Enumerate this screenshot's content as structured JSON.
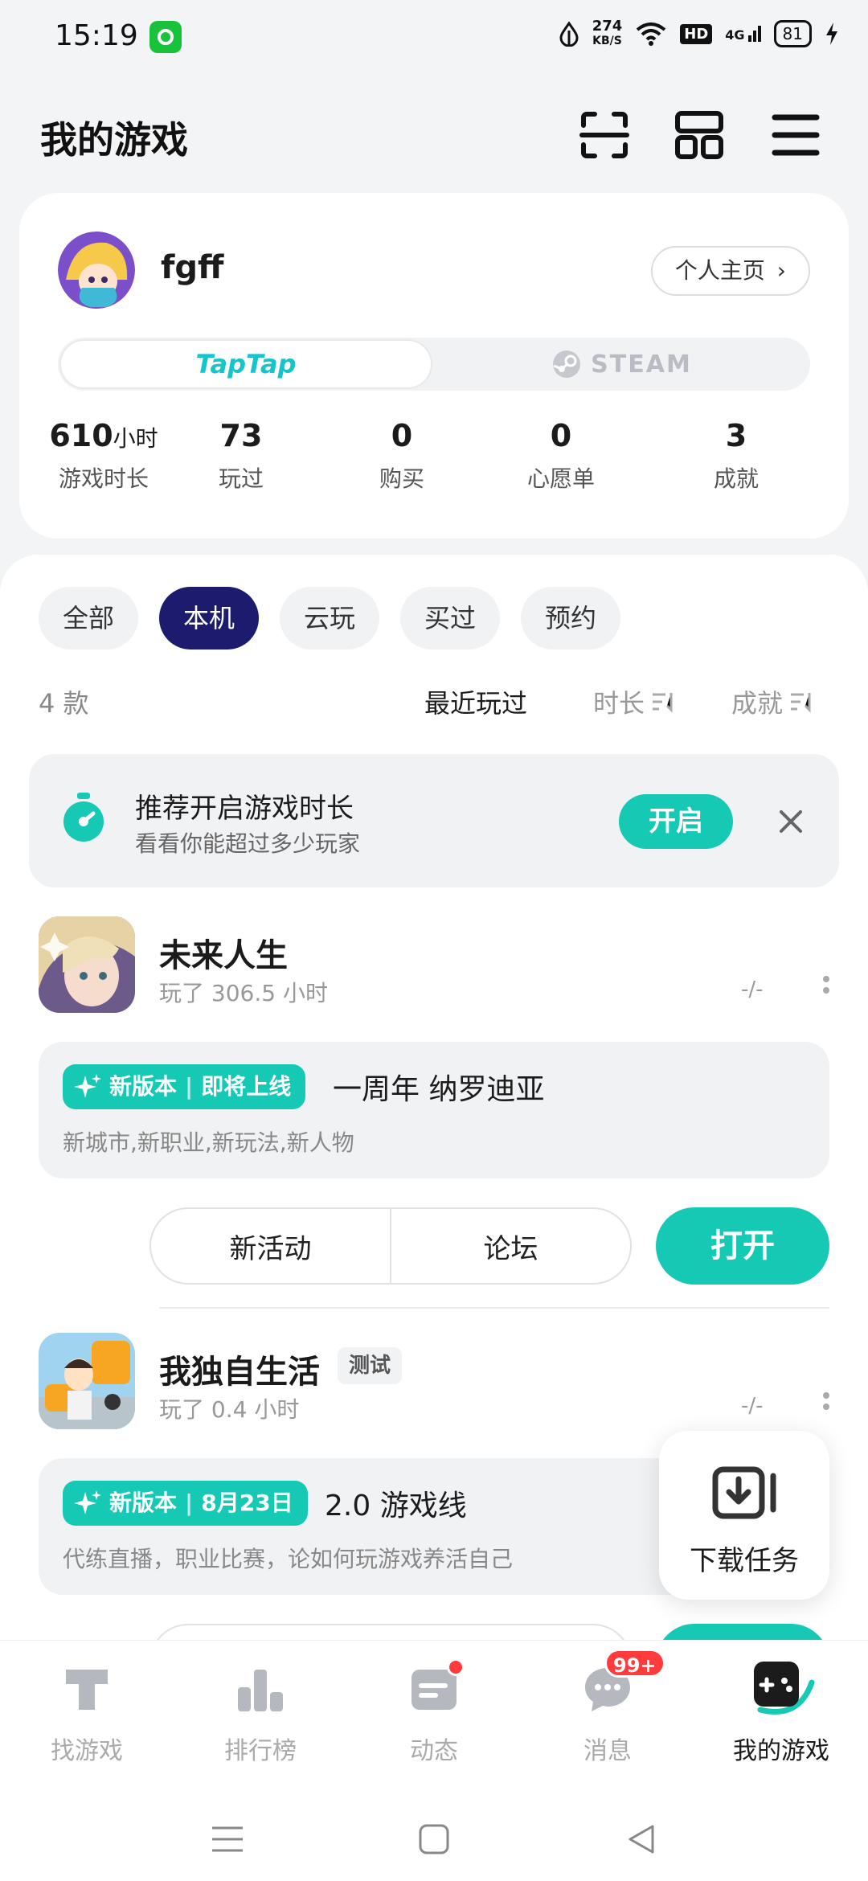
{
  "status_bar": {
    "time": "15:19",
    "net_speed_value": "274",
    "net_speed_unit": "KB/S",
    "hd": "HD",
    "signal": "4G",
    "battery": "81"
  },
  "header": {
    "title": "我的游戏"
  },
  "profile": {
    "username": "fgff",
    "homepage_label": "个人主页",
    "platform_taptap": "TapTap",
    "platform_steam": "STEAM",
    "stats": [
      {
        "value": "610",
        "unit": "小时",
        "label": "游戏时长"
      },
      {
        "value": "73",
        "unit": "",
        "label": "玩过"
      },
      {
        "value": "0",
        "unit": "",
        "label": "购买"
      },
      {
        "value": "0",
        "unit": "",
        "label": "心愿单"
      },
      {
        "value": "3",
        "unit": "",
        "label": "成就"
      }
    ]
  },
  "filters": {
    "chips": [
      "全部",
      "本机",
      "云玩",
      "买过",
      "预约"
    ],
    "active_chip": "本机",
    "count": "4 款",
    "sorts": [
      "最近玩过",
      "时长",
      "成就"
    ]
  },
  "recommendation": {
    "title": "推荐开启游戏时长",
    "subtitle": "看看你能超过多少玩家",
    "button": "开启"
  },
  "games": [
    {
      "name": "未来人生",
      "play_time": "玩了 306.5 小时",
      "rating": "-/-",
      "tag": "",
      "update": {
        "badge": "新版本",
        "badge_extra": "即将上线",
        "title": "一周年 纳罗迪亚",
        "desc": "新城市,新职业,新玩法,新人物"
      },
      "actions": [
        "新活动",
        "论坛"
      ],
      "open_label": "打开"
    },
    {
      "name": "我独自生活",
      "play_time": "玩了 0.4 小时",
      "rating": "-/-",
      "tag": "测试",
      "update": {
        "badge": "新版本",
        "badge_extra": "8月23日",
        "title": "2.0 游戏线",
        "desc": "代练直播，职业比赛，论如何玩游戏养活自己"
      }
    }
  ],
  "download_task": {
    "label": "下载任务"
  },
  "bottom_nav": {
    "items": [
      {
        "label": "找游戏",
        "icon": "find-game-icon"
      },
      {
        "label": "排行榜",
        "icon": "ranking-icon"
      },
      {
        "label": "动态",
        "icon": "feed-icon"
      },
      {
        "label": "消息",
        "icon": "message-icon",
        "badge": "99+"
      },
      {
        "label": "我的游戏",
        "icon": "my-games-icon"
      }
    ],
    "active": "我的游戏"
  },
  "colors": {
    "accent": "#15c9b5",
    "active_chip": "#1c1b6e",
    "badge_red": "#ff3b3b"
  }
}
